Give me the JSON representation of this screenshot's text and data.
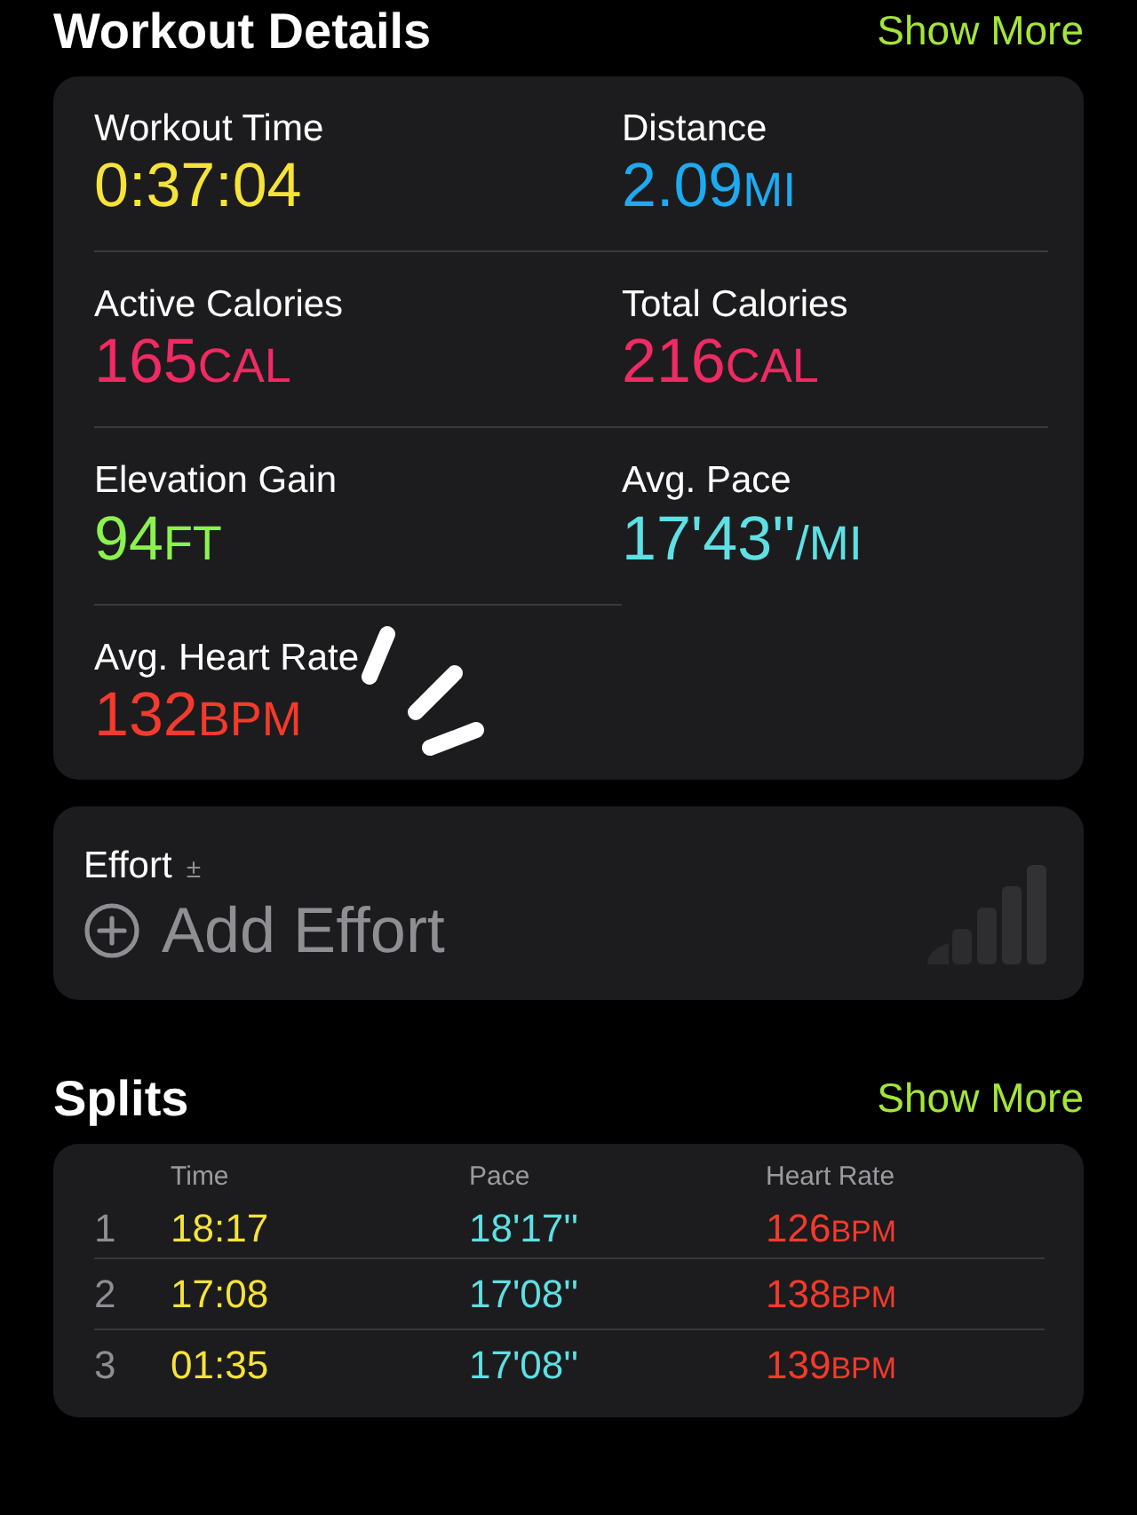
{
  "details": {
    "title": "Workout Details",
    "action": "Show More",
    "metrics": [
      {
        "label": "Workout Time",
        "value": "0:37:04",
        "color": "#f6e33a"
      },
      {
        "label": "Distance",
        "value": "2.09",
        "unit": "MI",
        "color": "#1eaaf1"
      },
      {
        "label": "Active Calories",
        "value": "165",
        "unit": "CAL",
        "color": "#f02a62"
      },
      {
        "label": "Total Calories",
        "value": "216",
        "unit": "CAL",
        "color": "#f02a62"
      },
      {
        "label": "Elevation Gain",
        "value": "94",
        "unit": "FT",
        "color": "#8cf24e"
      },
      {
        "label": "Avg. Pace",
        "value": "17'43''",
        "unit": "/MI",
        "color": "#5ee0e4"
      },
      {
        "label": "Avg. Heart Rate",
        "value": "132",
        "unit": "BPM",
        "color": "#f43a2c"
      }
    ]
  },
  "effort": {
    "label": "Effort",
    "symbol": "±",
    "action": "Add Effort"
  },
  "splits": {
    "title": "Splits",
    "action": "Show More",
    "columns": [
      "Time",
      "Pace",
      "Heart Rate"
    ],
    "rows": [
      {
        "index": "1",
        "time": "18:17",
        "pace": "18'17''",
        "heart_rate": "126",
        "unit": "BPM"
      },
      {
        "index": "2",
        "time": "17:08",
        "pace": "17'08''",
        "heart_rate": "138",
        "unit": "BPM"
      },
      {
        "index": "3",
        "time": "01:35",
        "pace": "17'08''",
        "heart_rate": "139",
        "unit": "BPM"
      }
    ]
  }
}
